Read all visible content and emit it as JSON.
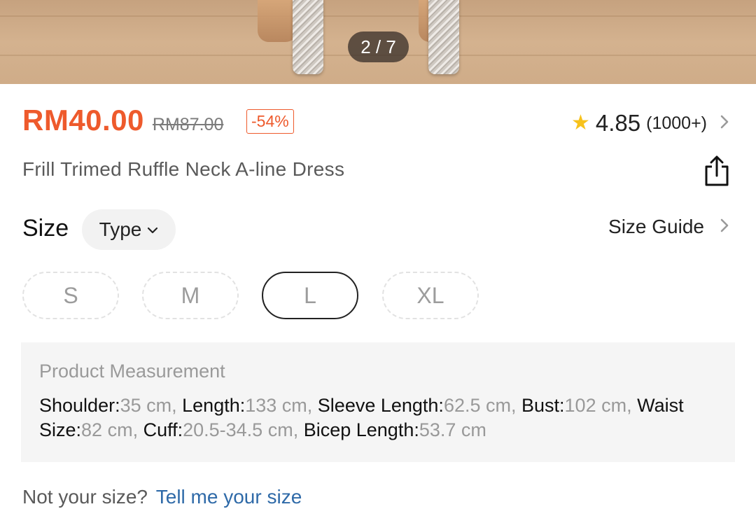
{
  "gallery": {
    "counter": "2 / 7"
  },
  "product": {
    "price": "RM40.00",
    "original_price": "RM87.00",
    "discount": "-54%",
    "rating": "4.85",
    "rating_count": "(1000+)",
    "title": "Frill Trimed Ruffle Neck A-line Dress"
  },
  "size_section": {
    "label": "Size",
    "type_chip": "Type",
    "size_guide": "Size Guide",
    "options": [
      {
        "label": "S",
        "selected": false
      },
      {
        "label": "M",
        "selected": false
      },
      {
        "label": "L",
        "selected": true
      },
      {
        "label": "XL",
        "selected": false
      }
    ]
  },
  "measurement": {
    "heading": "Product Measurement",
    "items": [
      {
        "key": "Shoulder:",
        "value": "35 cm"
      },
      {
        "key": "Length:",
        "value": "133 cm"
      },
      {
        "key": "Sleeve Length:",
        "value": "62.5 cm"
      },
      {
        "key": "Bust:",
        "value": "102 cm"
      },
      {
        "key": "Waist Size:",
        "value": "82 cm"
      },
      {
        "key": "Cuff:",
        "value": "20.5-34.5 cm"
      },
      {
        "key": "Bicep Length:",
        "value": "53.7 cm"
      }
    ]
  },
  "footer": {
    "prompt": "Not your size?",
    "link": "Tell me your size"
  },
  "colors": {
    "accent": "#ee5a2c",
    "star": "#f7c21b",
    "link": "#2f6aa8"
  },
  "icons": {
    "rating": "star-icon",
    "rating_more": "chevron-right-icon",
    "share": "share-icon",
    "type_caret": "chevron-down-icon",
    "size_guide_more": "chevron-right-icon"
  }
}
